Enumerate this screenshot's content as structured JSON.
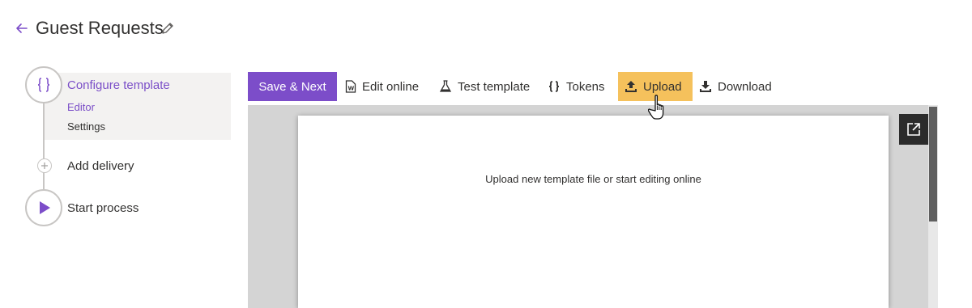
{
  "header": {
    "title": "Guest Requests",
    "back_icon": "arrow-left-icon",
    "edit_icon": "pencil-icon"
  },
  "steps": [
    {
      "label": "Configure template",
      "icon": "curly-braces-icon",
      "state": "active",
      "sub_items": [
        {
          "label": "Editor",
          "active": true
        },
        {
          "label": "Settings",
          "active": false
        }
      ]
    },
    {
      "label": "Add delivery",
      "icon": "plus-icon",
      "state": "pending"
    },
    {
      "label": "Start process",
      "icon": "play-icon",
      "state": "pending"
    }
  ],
  "toolbar": {
    "save_next": "Save & Next",
    "edit_online": "Edit online",
    "test_template": "Test template",
    "tokens": "Tokens",
    "upload": "Upload",
    "download": "Download"
  },
  "preview": {
    "message": "Upload new template file or start editing online",
    "open_icon": "open-external-icon"
  },
  "colors": {
    "accent": "#7c4dc9",
    "upload_highlight": "#f5c15c",
    "active_step_bg": "#f3f2f1"
  }
}
